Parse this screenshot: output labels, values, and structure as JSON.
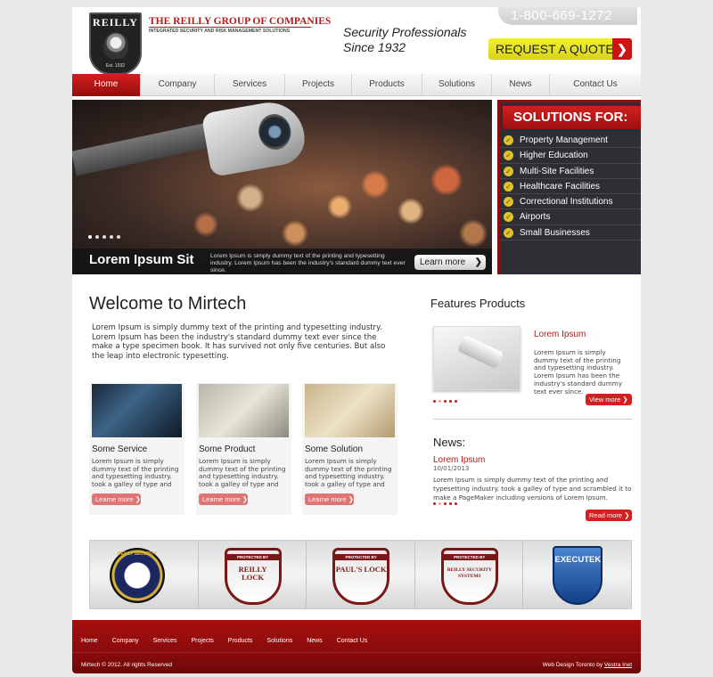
{
  "header": {
    "logo_text": "REILLY",
    "logo_est": "Est. 1932",
    "company_name": "THE REILLY GROUP OF COMPANIES",
    "company_tagline": "INTEGRATED SECURITY AND RISK MANAGEMENT SOLUTIONS",
    "tagline_line1": "Security Professionals",
    "tagline_line2": "Since 1932",
    "phone": "1-800-669-1272",
    "quote_label": "REQUEST A QUOTE"
  },
  "nav": {
    "items": [
      {
        "label": "Home"
      },
      {
        "label": "Company"
      },
      {
        "label": "Services"
      },
      {
        "label": "Projects"
      },
      {
        "label": "Products"
      },
      {
        "label": "Solutions"
      },
      {
        "label": "News"
      },
      {
        "label": "Contact Us"
      }
    ],
    "active": "Home"
  },
  "hero": {
    "caption_title": "Lorem Ipsum Sit",
    "caption_text": "Lorem Ipsum is simply dummy text of the printing and typesetting industry. Lorem Ipsum has been the industry's standard dummy text ever since.",
    "learn_more": "Learn more"
  },
  "solutions": {
    "title": "SOLUTIONS FOR:",
    "items": [
      "Property Management",
      "Higher Education",
      "Multi-Site Facilities",
      "Healthcare Facilities",
      "Correctional Institutions",
      "Airports",
      "Small Businesses"
    ]
  },
  "welcome": {
    "title": "Welcome to Mirtech",
    "text": "Lorem Ipsum is simply dummy text of the printing and typesetting industry. Lorem Ipsum has been the industry's standard dummy text ever since the make a type specimen book. It has survived not only five centuries. But also the leap into electronic typesetting."
  },
  "cards": [
    {
      "title": "Some Service",
      "text": "Lorem Ipsum is simply dummy text of the printing and typesetting industry. took a galley of type and",
      "button": "Learne more"
    },
    {
      "title": "Some Product",
      "text": "Lorem Ipsum is simply dummy text of the printing and typesetting industry. took a galley of type and",
      "button": "Learne more"
    },
    {
      "title": "Some Solution",
      "text": "Lorem Ipsum is simply dummy text of the printing and typesetting industry. took a galley of type and",
      "button": "Learne more"
    }
  ],
  "features": {
    "title": "Features Products",
    "item_name": "Lorem Ipsum",
    "item_text": "Lorem Ipsum is simply dummy text of the printing and typesetting industry. Lorem Ipsum has been the industry's standard dummy text ever since.",
    "button": "View more"
  },
  "news": {
    "title": "News:",
    "item_name": "Lorem Ipsum",
    "date": "10/01/2013",
    "text": "Lorem Ipsum is simply dummy text of the printing and typesetting industry. took a galley of type and scrambled it to make a PageMaker including versions of Lorem Ipsum.",
    "button": "Read more"
  },
  "partners": [
    {
      "name": "REILLY SECURITY",
      "type": "round"
    },
    {
      "banner": "PROTECTED BY",
      "name": "REILLY LOCK",
      "type": "shield"
    },
    {
      "banner": "PROTECTED BY",
      "name": "PAUL'S LOCK",
      "type": "shield"
    },
    {
      "banner": "PROTECTED BY",
      "name": "REILLY SECURITY SYSTEMS",
      "type": "shield"
    },
    {
      "name": "EXECUTEK",
      "type": "shield-blue"
    }
  ],
  "footer": {
    "nav": [
      "Home",
      "Company",
      "Services",
      "Projects",
      "Products",
      "Solutions",
      "News",
      "Contact Us"
    ],
    "copyright": "Mirtech © 2012. All rights Reserved",
    "credit_prefix": "Web Design Toronto by",
    "credit_link": "Vestra Inet"
  },
  "colors": {
    "brand_red": "#b01c1c",
    "quote_yellow": "#f2ef37",
    "solutions_bg": "#2d2f35"
  }
}
